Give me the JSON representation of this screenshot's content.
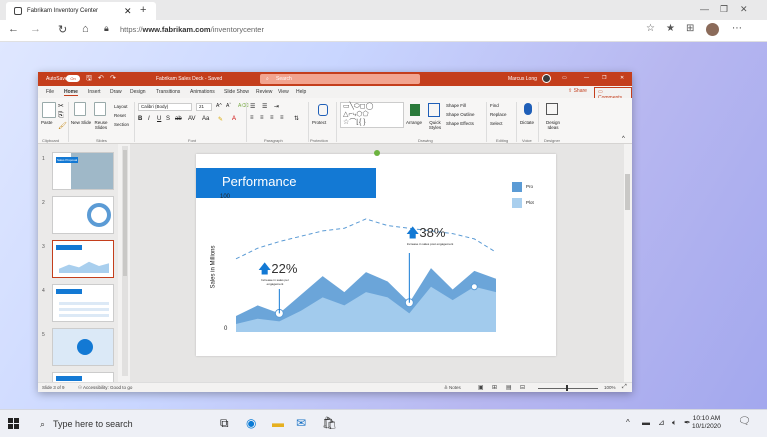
{
  "browser": {
    "tab_title": "Fabrikam Inventory Center",
    "url_prefix": "https://",
    "url_domain": "www.fabrikam.com",
    "url_path": "/inventorycenter"
  },
  "ppt": {
    "autosave_label": "AutoSave",
    "autosave_state": "On",
    "doc_title": "Fabrikam Sales Deck - Saved",
    "search_placeholder": "Search",
    "user_name": "Marcus Long",
    "menus": [
      "File",
      "Home",
      "Insert",
      "Draw",
      "Design",
      "Transitions",
      "Animations",
      "Slide Show",
      "Review",
      "View",
      "Help"
    ],
    "active_menu": "Home",
    "share_label": "Share",
    "comments_label": "Comments",
    "ribbon": {
      "paste": "Paste",
      "new_slide": "New Slide",
      "reuse_slides": "Reuse Slides",
      "layout": "Layout",
      "reset": "Reset",
      "section": "Section",
      "font_name": "Calibri (Body)",
      "font_size": "21",
      "protect": "Protect",
      "arrange": "Arrange",
      "quick_styles": "Quick Styles",
      "shape_fill": "Shape Fill",
      "shape_outline": "Shape Outline",
      "shape_effects": "Shape Effects",
      "find": "Find",
      "replace": "Replace",
      "select": "Select",
      "dictate": "Dictate",
      "design_ideas": "Design Ideas",
      "groups": [
        "Clipboard",
        "Slides",
        "Font",
        "Paragraph",
        "Protection",
        "Drawing",
        "Editing",
        "Voice",
        "Designer"
      ]
    },
    "thumbnails": [
      {
        "num": "1",
        "title": "Sales Proposal"
      },
      {
        "num": "2",
        "title": ""
      },
      {
        "num": "3",
        "title": ""
      },
      {
        "num": "4",
        "title": ""
      },
      {
        "num": "5",
        "title": ""
      }
    ],
    "selected_slide": 3,
    "status_left": "Slide 3 of 9",
    "accessibility": "Accessibility: Good to go",
    "notes_label": "Notes",
    "zoom": "100%"
  },
  "slide": {
    "title": "Performance",
    "ylabel": "Sales in Millions",
    "y_top": "100",
    "y_bottom": "0",
    "legend": [
      "Pro",
      "Plot"
    ],
    "callout1_value": "22%",
    "callout1_caption": "Increase in sales per engagement",
    "callout2_value": "38%",
    "callout2_caption": "Increase in sales post engagement"
  },
  "chart_data": {
    "type": "area",
    "x": [
      0,
      1,
      2,
      3,
      4,
      5,
      6,
      7,
      8,
      9,
      10,
      11,
      12
    ],
    "series": [
      {
        "name": "Pro",
        "values": [
          12,
          20,
          14,
          28,
          42,
          30,
          45,
          38,
          22,
          48,
          32,
          46,
          40
        ],
        "color": "#5b9bd5"
      },
      {
        "name": "Plot",
        "values": [
          6,
          10,
          8,
          16,
          26,
          20,
          30,
          26,
          14,
          34,
          24,
          34,
          30
        ],
        "color": "#a9cfee"
      }
    ],
    "trend_dashed": [
      55,
      63,
      68,
      72,
      76,
      78,
      85,
      80,
      78,
      76,
      74,
      70,
      60
    ],
    "ylim": [
      0,
      100
    ],
    "grid": false,
    "legend_position": "top-right"
  },
  "taskbar": {
    "search_placeholder": "Type here to search",
    "time": "10:10 AM",
    "date": "10/1/2020"
  },
  "colors": {
    "accent": "#c43e1c",
    "slide_blue": "#1379d4"
  }
}
